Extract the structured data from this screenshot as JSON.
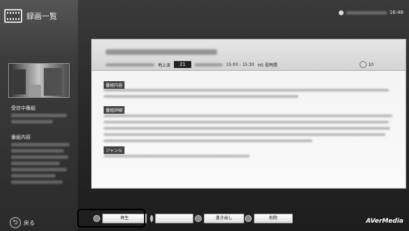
{
  "sidebar": {
    "title": "録画一覧",
    "icon": "film-icon",
    "now_playing_label": "受信中番組",
    "program_content_label": "番組内容",
    "back_label": "戻る"
  },
  "topbar": {
    "clock": "16:48"
  },
  "panel": {
    "broadcast_type": "地上波",
    "channel": "21",
    "time_range": "15:00 - 15:30",
    "quality": "HS 長時間",
    "rating": "10",
    "sections": {
      "content_label": "番組内容",
      "detail_label": "番組詳細",
      "genre_label": "ジャンル"
    }
  },
  "bottombar": {
    "play_label": "再生",
    "export_label": "書き出し",
    "delete_label": "削除",
    "logo": "AVerMedia"
  }
}
